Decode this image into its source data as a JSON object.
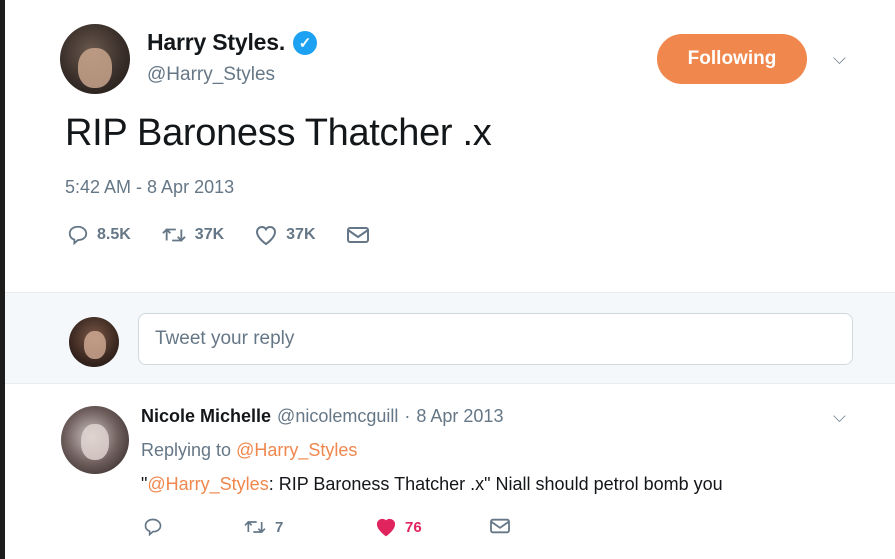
{
  "tweet": {
    "display_name": "Harry Styles.",
    "handle": "@Harry_Styles",
    "verified_icon": "verified-badge-icon",
    "follow_button_label": "Following",
    "text": "RIP Baroness Thatcher .x",
    "timestamp": "5:42 AM - 8 Apr 2013",
    "stats": {
      "replies": "8.5K",
      "retweets": "37K",
      "likes": "37K"
    }
  },
  "reply_box": {
    "placeholder": "Tweet your reply"
  },
  "reply": {
    "display_name": "Nicole Michelle",
    "handle": "@nicolemcguill",
    "separator": "·",
    "date": "8 Apr 2013",
    "replying_prefix": "Replying to",
    "replying_to": "@Harry_Styles",
    "quote_open": "\"",
    "quote_mention": "@Harry_Styles",
    "quote_text": ": RIP Baroness Thatcher .x\" Niall should petrol bomb you",
    "stats": {
      "retweets": "7",
      "likes": "76"
    }
  },
  "colors": {
    "accent": "#f0874d",
    "verified": "#1da1f2",
    "liked": "#e0245e",
    "muted": "#657786"
  }
}
